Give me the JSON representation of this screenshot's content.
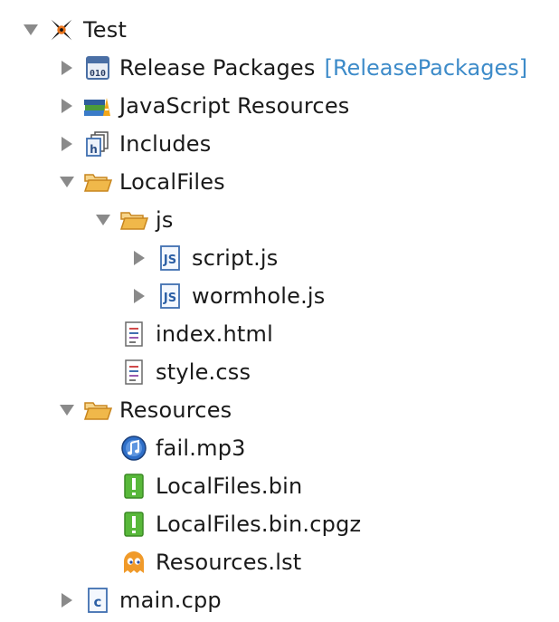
{
  "tree": {
    "root": {
      "label": "Test",
      "icon": "project-x-icon"
    },
    "release_packages": {
      "label": "Release Packages",
      "tag": "[ReleasePackages]",
      "icon": "binary-package-icon"
    },
    "javascript_resources": {
      "label": "JavaScript Resources",
      "icon": "library-books-icon"
    },
    "includes": {
      "label": "Includes",
      "icon": "header-includes-icon"
    },
    "localfiles": {
      "label": "LocalFiles",
      "icon": "folder-open-icon"
    },
    "js_folder": {
      "label": "js",
      "icon": "folder-open-icon"
    },
    "script_js": {
      "label": "script.js",
      "icon": "js-file-icon"
    },
    "wormhole_js": {
      "label": "wormhole.js",
      "icon": "js-file-icon"
    },
    "index_html": {
      "label": "index.html",
      "icon": "text-file-icon"
    },
    "style_css": {
      "label": "style.css",
      "icon": "text-file-icon"
    },
    "resources": {
      "label": "Resources",
      "icon": "folder-open-icon"
    },
    "fail_mp3": {
      "label": "fail.mp3",
      "icon": "music-note-icon"
    },
    "localfiles_bin": {
      "label": "LocalFiles.bin",
      "icon": "green-warning-icon"
    },
    "localfiles_bin_cpgz": {
      "label": "LocalFiles.bin.cpgz",
      "icon": "green-warning-icon"
    },
    "resources_lst": {
      "label": "Resources.lst",
      "icon": "ghost-icon"
    },
    "main_cpp": {
      "label": "main.cpp",
      "icon": "c-source-file-icon"
    }
  },
  "colors": {
    "twisty": "#8a8a8a",
    "folder": "#f0b84a",
    "tag_blue": "#3d8bc9",
    "green": "#58b83a",
    "orange": "#f09a2a"
  }
}
